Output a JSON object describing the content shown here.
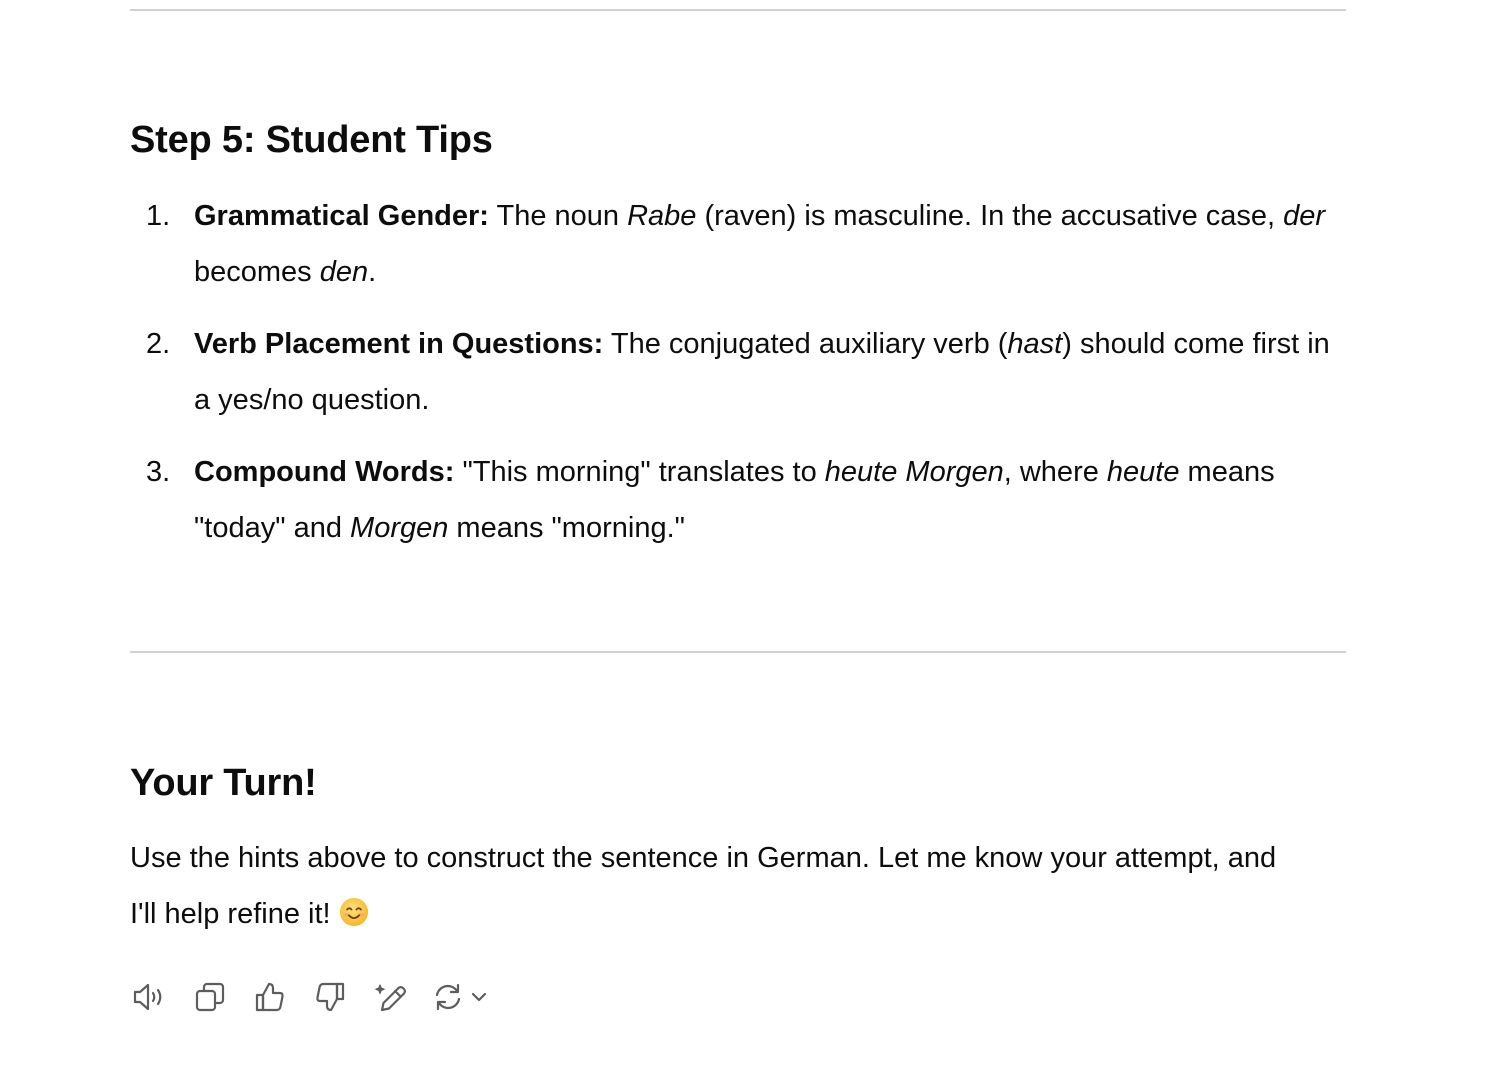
{
  "step5": {
    "heading": "Step 5: Student Tips",
    "tips": [
      {
        "num": "1.",
        "term": "Grammatical Gender:",
        "t1": " The noun ",
        "i1": "Rabe",
        "t2": " (raven) is masculine. In the accusative case, ",
        "i2": "der",
        "t3": " becomes ",
        "i3": "den",
        "t4": "."
      },
      {
        "num": "2.",
        "term": "Verb Placement in Questions:",
        "t1": " The conjugated auxiliary verb (",
        "i1": "hast",
        "t2": ") should come first in a yes/no question."
      },
      {
        "num": "3.",
        "term": "Compound Words:",
        "t1": " \"This morning\" translates to ",
        "i1": "heute Morgen",
        "t2": ", where ",
        "i2": "heute",
        "t3": " means \"today\" and ",
        "i3": "Morgen",
        "t4": " means \"morning.\""
      }
    ]
  },
  "your_turn": {
    "heading": "Your Turn!",
    "text": "Use the hints above to construct the sentence in German. Let me know your attempt, and I'll help refine it! ",
    "emoji": "smiling-face-emoji"
  },
  "toolbar": {
    "icons": [
      "speaker-icon",
      "copy-icon",
      "thumbs-up-icon",
      "thumbs-down-icon",
      "edit-sparkle-icon",
      "regenerate-icon",
      "chevron-down-icon"
    ],
    "icon_color": "#5d5d5d"
  }
}
